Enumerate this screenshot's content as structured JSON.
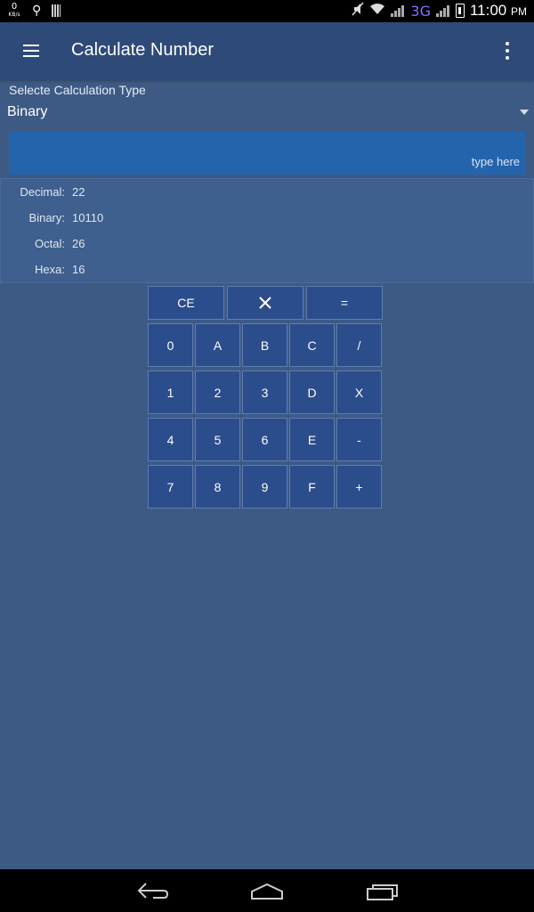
{
  "status_bar": {
    "kbs_value": "0",
    "kbs_unit": "KB/s",
    "network": "3G",
    "time": "11:00",
    "ampm": "PM"
  },
  "app_bar": {
    "title": "Calculate Number"
  },
  "calc_type": {
    "label": "Selecte Calculation Type",
    "selected": "Binary"
  },
  "input": {
    "value": "",
    "placeholder": "type here"
  },
  "results": [
    {
      "label": "Decimal:",
      "value": "22"
    },
    {
      "label": "Binary:",
      "value": "10110"
    },
    {
      "label": "Octal:",
      "value": "26"
    },
    {
      "label": "Hexa:",
      "value": "16"
    }
  ],
  "keypad": {
    "ce": "CE",
    "equals": "=",
    "rows": [
      [
        "0",
        "A",
        "B",
        "C",
        "/"
      ],
      [
        "1",
        "2",
        "3",
        "D",
        "X"
      ],
      [
        "4",
        "5",
        "6",
        "E",
        "-"
      ],
      [
        "7",
        "8",
        "9",
        "F",
        "+"
      ]
    ]
  },
  "colors": {
    "background": "#3d5a85",
    "app_bar": "#2e4a78",
    "input": "#2464ad",
    "key": "#2b4d8c"
  }
}
